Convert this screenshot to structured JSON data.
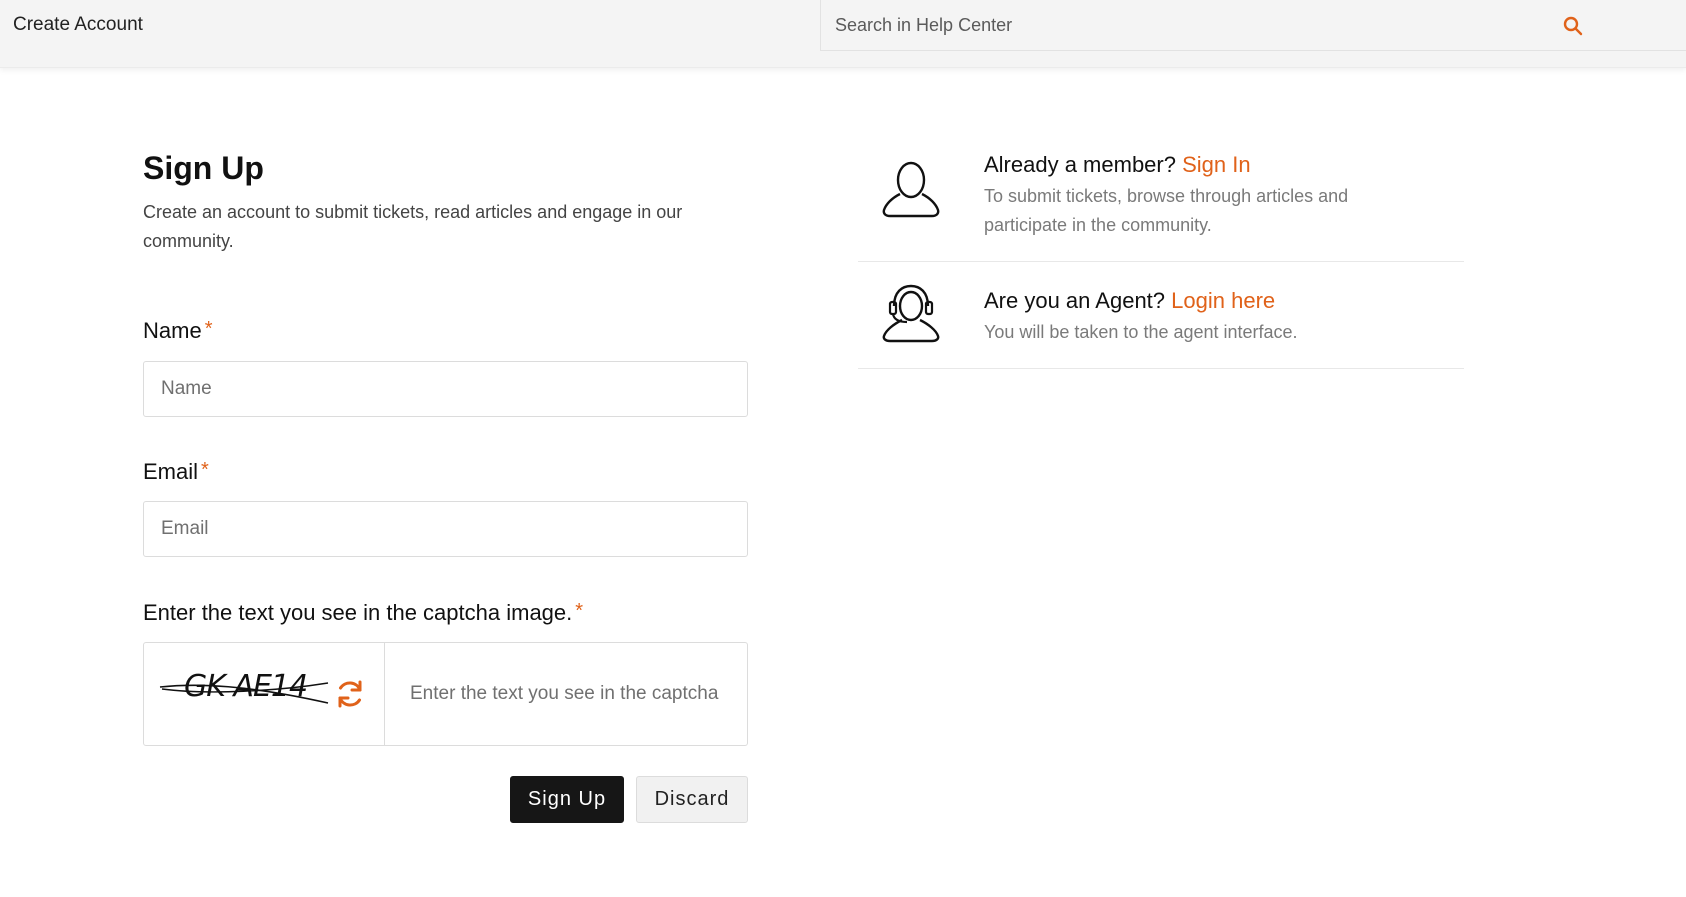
{
  "header": {
    "breadcrumb": "Create Account",
    "search_placeholder": "Search in Help Center"
  },
  "signup": {
    "title": "Sign Up",
    "subtitle": "Create an account to submit tickets, read articles and engage in our community.",
    "name_label": "Name",
    "name_placeholder": "Name",
    "email_label": "Email",
    "email_placeholder": "Email",
    "required_mark": "*",
    "captcha_label": "Enter the text you see in the captcha image.",
    "captcha_text": "GK AE14",
    "captcha_placeholder": "Enter the text you see in the captcha image",
    "submit_label": "Sign Up",
    "discard_label": "Discard"
  },
  "sidebar": {
    "member": {
      "question": "Already a member?",
      "link": "Sign In",
      "description": "To submit tickets, browse through articles and participate in the community."
    },
    "agent": {
      "question": "Are you an Agent?",
      "link": "Login here",
      "description": "You will be taken to the agent interface."
    }
  },
  "colors": {
    "accent": "#e0621a",
    "primary_button": "#161616",
    "header_bg": "#f4f4f4"
  },
  "icons": [
    "search-icon",
    "refresh-icon",
    "user-icon",
    "agent-headset-icon"
  ]
}
